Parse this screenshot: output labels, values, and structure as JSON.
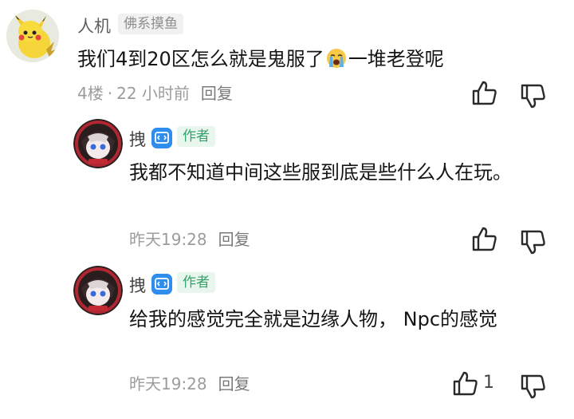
{
  "comment": {
    "user": "人机",
    "tag": "佛系摸鱼",
    "avatar_icon": "pikachu-avatar",
    "content_before_emoji": "我们4到20区怎么就是鬼服了",
    "emoji": "crying-face-emoji",
    "content_after_emoji": "一堆老登呢",
    "floor": "4楼",
    "separator": "·",
    "time": "22 小时前",
    "reply_label": "回复"
  },
  "replies": [
    {
      "user": "拽",
      "author_badge": "作者",
      "avatar_icon": "anime-character-avatar",
      "content": "我都不知道中间这些服到底是些什么人在玩。",
      "time": "昨天19:28",
      "reply_label": "回复",
      "likes": ""
    },
    {
      "user": "拽",
      "author_badge": "作者",
      "avatar_icon": "anime-character-avatar",
      "content": "给我的感觉完全就是边缘人物， Npc的感觉",
      "time": "昨天19:28",
      "reply_label": "回复",
      "likes": "1"
    }
  ],
  "colors": {
    "author_badge_text": "#33a36b",
    "author_badge_bg": "#e8f6ee",
    "author_icon_bg": "#2f8dee",
    "meta_text": "#9c9c9c"
  }
}
